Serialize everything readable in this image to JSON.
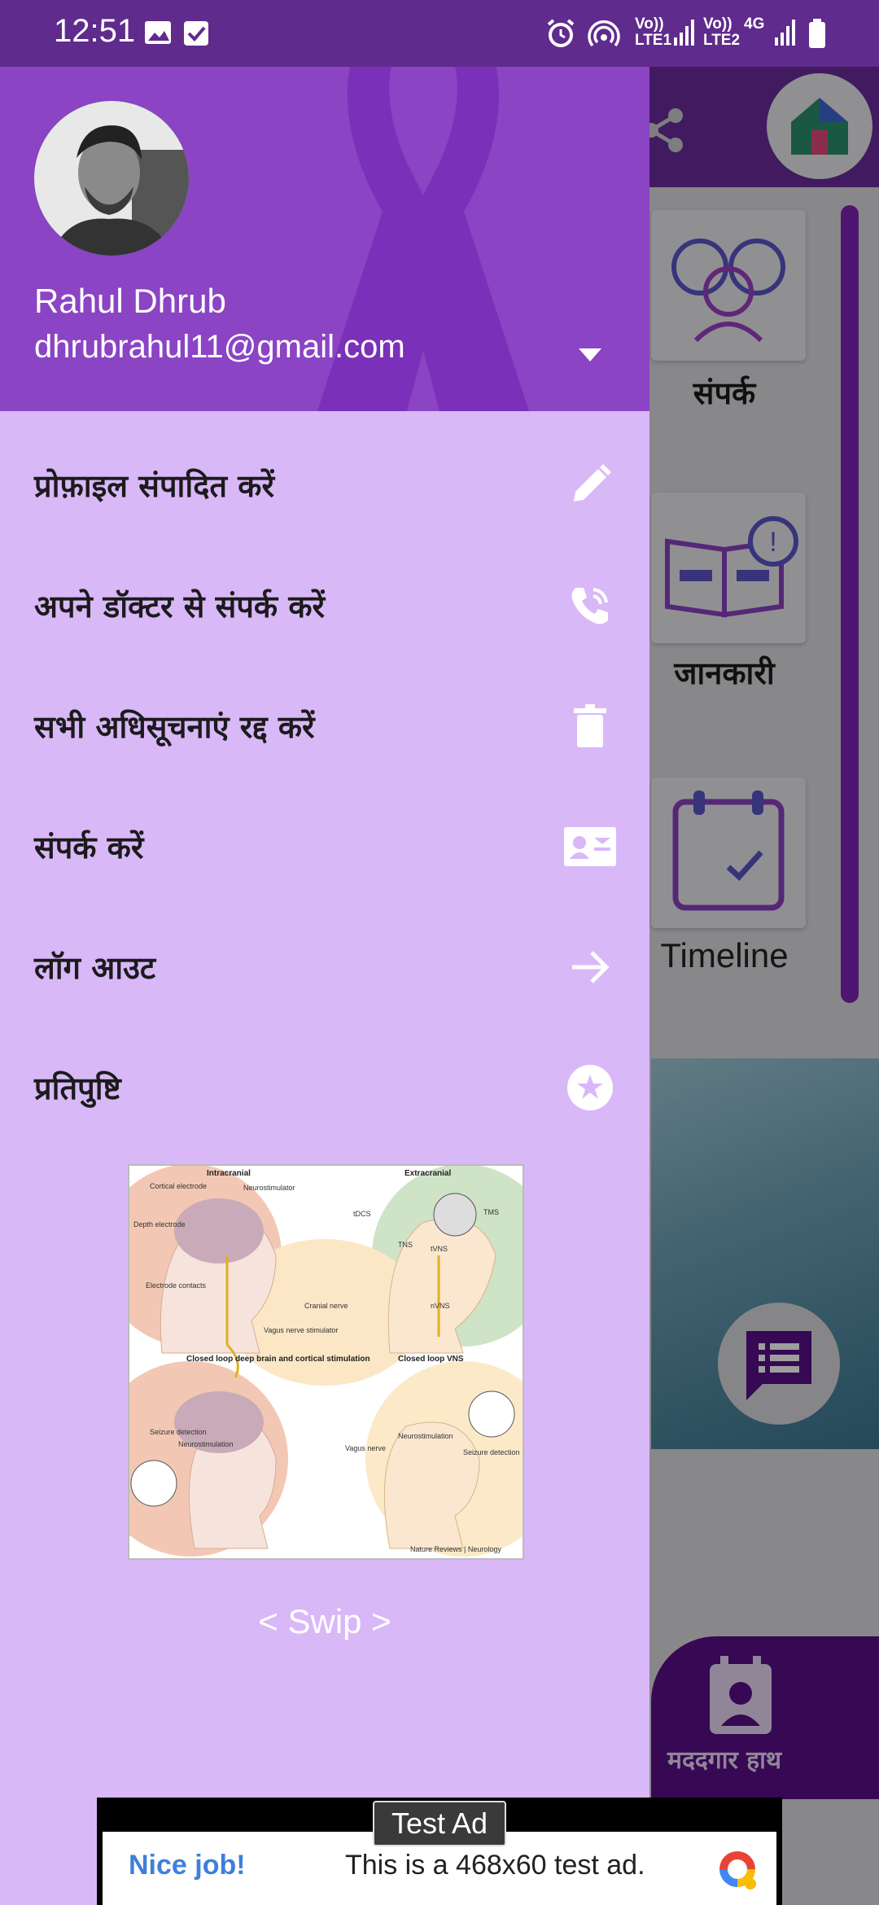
{
  "status_bar": {
    "time": "12:51",
    "sim1": "Vo)) LTE1",
    "sim2": "Vo)) LTE2",
    "network": "4G"
  },
  "background_app": {
    "cards": [
      {
        "label": "संपर्क",
        "icon": "people-icon"
      },
      {
        "label": "जानकारी",
        "icon": "book-info-icon"
      },
      {
        "label": "Timeline",
        "icon": "calendar-check-icon"
      }
    ],
    "bottom_nav_label": "मददगार हाथ",
    "accent": "#7e25b7"
  },
  "drawer": {
    "user_name": "Rahul Dhrub",
    "user_email": "dhrubrahul11@gmail.com",
    "header_color": "#8a44c4",
    "background_color": "#d9b8f8",
    "menu": [
      {
        "label": "प्रोफ़ाइल संपादित करें",
        "icon": "pencil-icon"
      },
      {
        "label": "अपने डॉक्टर से संपर्क करें",
        "icon": "phone-call-icon"
      },
      {
        "label": "सभी अधिसूचनाएं रद्द करें",
        "icon": "trash-icon"
      },
      {
        "label": "संपर्क करें",
        "icon": "contact-card-icon"
      },
      {
        "label": "लॉग आउट",
        "icon": "arrow-right-icon"
      },
      {
        "label": "प्रतिपुष्टि",
        "icon": "star-circle-icon"
      }
    ],
    "illustration": {
      "intracranial": "Intracranial",
      "extracranial": "Extracranial",
      "cortical_electrode": "Cortical electrode",
      "neurostimulator": "Neurostimulator",
      "depth_electrode": "Depth electrode",
      "electrode_contacts": "Electrode contacts",
      "cranial_nerve": "Cranial nerve",
      "vagus_stimulator": "Vagus nerve stimulator",
      "tdcs": "tDCS",
      "tms": "TMS",
      "tns": "TNS",
      "tvns": "tVNS",
      "nvns": "nVNS",
      "closed_loop_dbs": "Closed loop deep brain and cortical stimulation",
      "closed_loop_vns": "Closed loop VNS",
      "seizure_detection": "Seizure detection",
      "neurostimulation": "Neurostimulation",
      "vagus_nerve": "Vagus nerve",
      "credit": "Nature Reviews | Neurology"
    },
    "swipe_hint": "< Swip >"
  },
  "ad": {
    "badge": "Test Ad",
    "headline": "Nice job!",
    "text": "This is a 468x60 test ad."
  }
}
